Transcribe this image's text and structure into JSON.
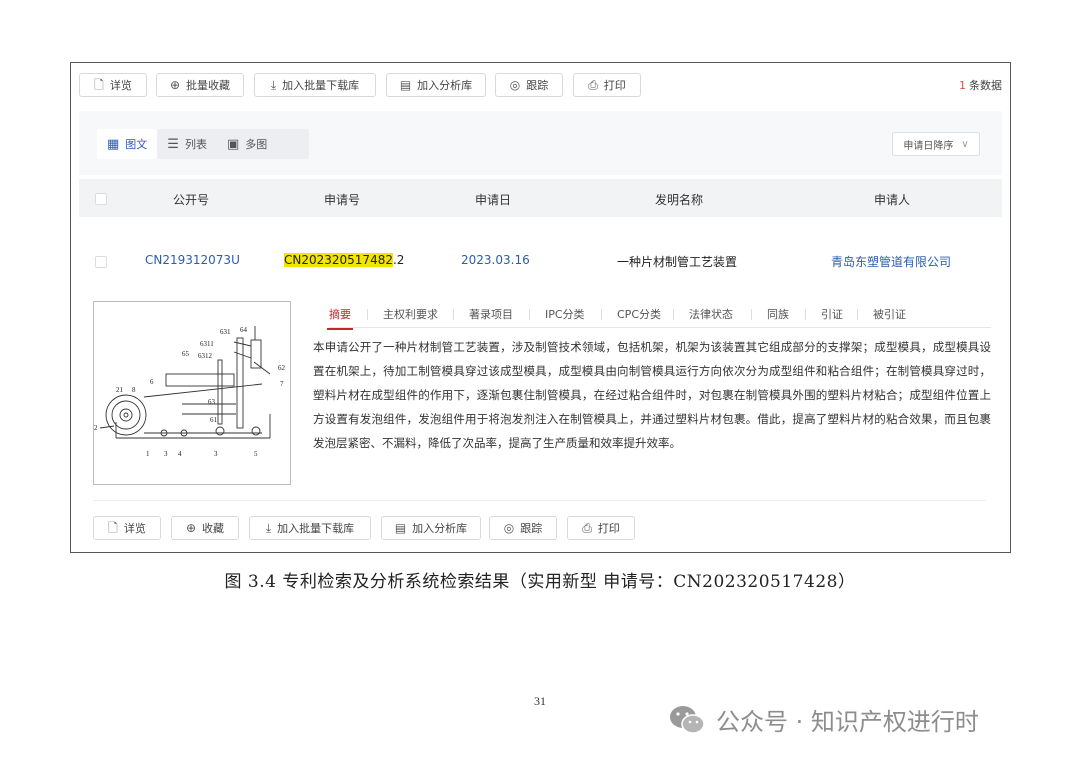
{
  "toolbar": {
    "buttons": [
      {
        "icon": "file-detail-icon",
        "glyph": "🗋",
        "label": "详览"
      },
      {
        "icon": "batch-collect-icon",
        "glyph": "⊕",
        "label": "批量收藏"
      },
      {
        "icon": "download-icon",
        "glyph": "⤓",
        "label": "加入批量下载库"
      },
      {
        "icon": "analysis-icon",
        "glyph": "▤",
        "label": "加入分析库"
      },
      {
        "icon": "track-icon",
        "glyph": "◎",
        "label": "跟踪"
      },
      {
        "icon": "print-icon",
        "glyph": "⎙",
        "label": "打印"
      }
    ],
    "count_num": "1",
    "count_text": "条数据"
  },
  "view_tabs": [
    {
      "icon": "image-text-icon",
      "glyph": "▦",
      "label": "图文"
    },
    {
      "icon": "list-icon",
      "glyph": "☰",
      "label": "列表"
    },
    {
      "icon": "multi-image-icon",
      "glyph": "▣",
      "label": "多图"
    }
  ],
  "sort": {
    "label": "申请日降序",
    "icon": "chevron-down-icon",
    "glyph": "∨"
  },
  "table": {
    "headers": [
      "公开号",
      "申请号",
      "申请日",
      "发明名称",
      "申请人"
    ],
    "row": {
      "pub_no": "CN219312073U",
      "app_no_highlight": "CN202320517482",
      "app_no_rest": ".2",
      "app_date": "2023.03.16",
      "title": "一种片材制管工艺装置",
      "applicant": "青岛东塑管道有限公司"
    }
  },
  "figure_labels": [
    "631",
    "64",
    "6311",
    "6312",
    "65",
    "6",
    "62",
    "7",
    "21",
    "8",
    "63",
    "61",
    "2",
    "1",
    "3",
    "4",
    "3",
    "5"
  ],
  "detail_tabs": [
    "摘要",
    "主权利要求",
    "著录项目",
    "IPC分类",
    "CPC分类",
    "法律状态",
    "同族",
    "引证",
    "被引证"
  ],
  "abstract": "本申请公开了一种片材制管工艺装置，涉及制管技术领域，包括机架，机架为该装置其它组成部分的支撑架；成型模具，成型模具设置在机架上，待加工制管模具穿过该成型模具，成型模具由向制管模具运行方向依次分为成型组件和粘合组件；在制管模具穿过时，塑料片材在成型组件的作用下，逐渐包裹住制管模具，在经过粘合组件时，对包裹在制管模具外围的塑料片材粘合；成型组件位置上方设置有发泡组件，发泡组件用于将泡发剂注入在制管模具上，并通过塑料片材包裹。借此，提高了塑料片材的粘合效果，而且包裹发泡层紧密、不漏料，降低了次品率，提高了生产质量和效率提升效率。",
  "bottom_buttons": [
    {
      "icon": "file-detail-icon",
      "glyph": "🗋",
      "label": "详览"
    },
    {
      "icon": "collect-icon",
      "glyph": "⊕",
      "label": "收藏"
    },
    {
      "icon": "download-icon",
      "glyph": "⤓",
      "label": "加入批量下载库"
    },
    {
      "icon": "analysis-icon",
      "glyph": "▤",
      "label": "加入分析库"
    },
    {
      "icon": "track-icon",
      "glyph": "◎",
      "label": "跟踪"
    },
    {
      "icon": "print-icon",
      "glyph": "⎙",
      "label": "打印"
    }
  ],
  "caption": "图 3.4  专利检索及分析系统检索结果（实用新型  申请号：CN202320517428）",
  "page_number": "31",
  "watermark": {
    "text": "公众号 · 知识产权进行时",
    "icon": "wechat-icon"
  }
}
